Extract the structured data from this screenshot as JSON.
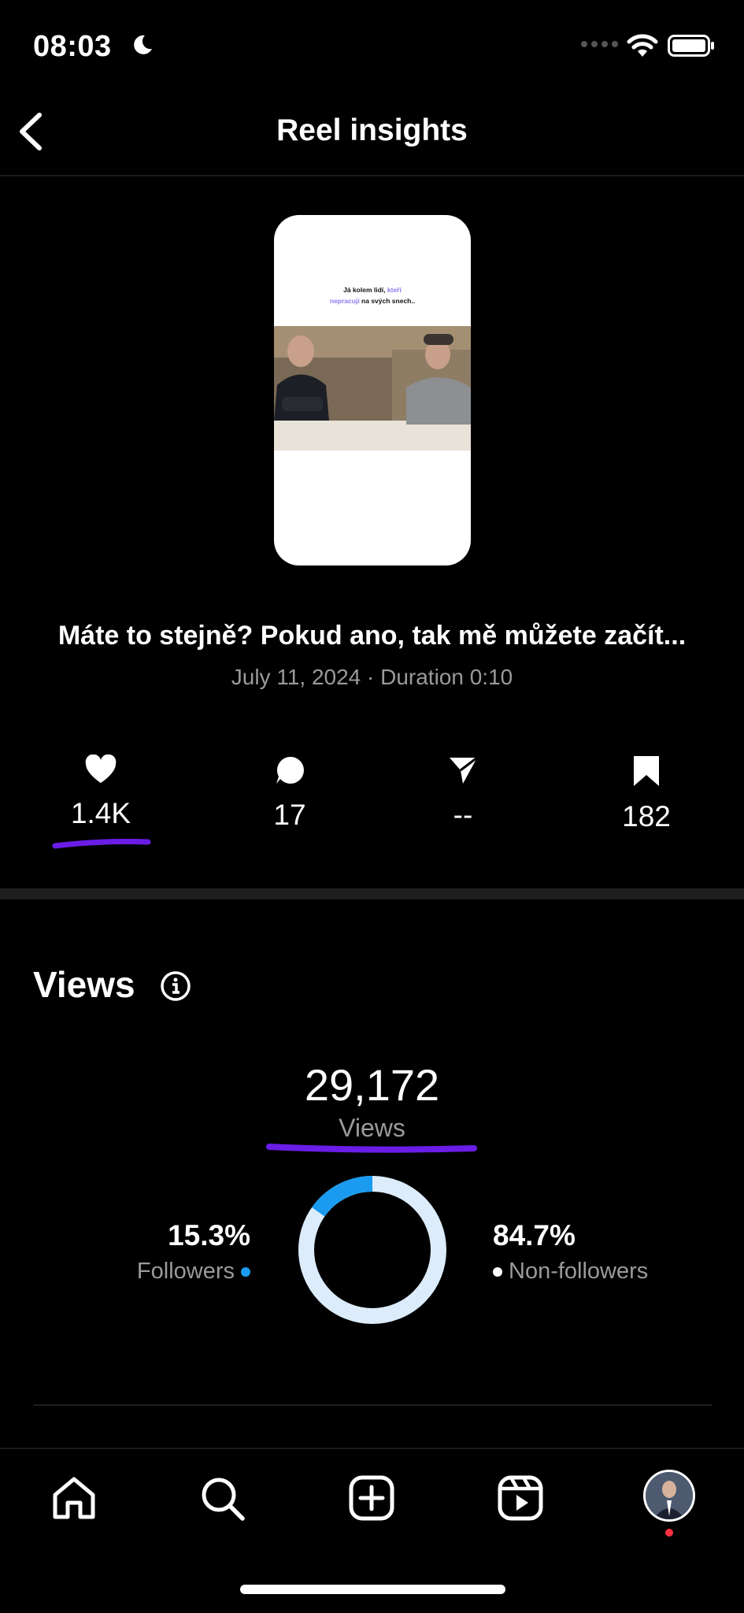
{
  "status": {
    "time": "08:03"
  },
  "header": {
    "title": "Reel insights"
  },
  "reel": {
    "thumbnail_caption_part1": "Já kolem lidí, ",
    "thumbnail_caption_highlight1": "kteří",
    "thumbnail_caption_highlight2": "nepracují",
    "thumbnail_caption_part2": " na svých snech..",
    "title": "Máte to stejně? Pokud ano, tak mě můžete začít...",
    "meta": "July 11, 2024 · Duration 0:10"
  },
  "stats": {
    "likes": "1.4K",
    "comments": "17",
    "shares": "--",
    "saves": "182"
  },
  "views": {
    "heading": "Views",
    "total": "29,172",
    "label": "Views",
    "followers_pct": "15.3%",
    "followers_label": "Followers",
    "followers_fraction": 0.153,
    "nonfollowers_pct": "84.7%",
    "nonfollowers_label": "Non-followers",
    "colors": {
      "followers": "#1a9bf0",
      "nonfollowers": "#dcecfb"
    }
  },
  "nav": {
    "items": [
      "home-icon",
      "search-icon",
      "create-icon",
      "reels-icon",
      "profile-avatar"
    ]
  },
  "annotations": {
    "scribble_color": "#6a1de6"
  }
}
